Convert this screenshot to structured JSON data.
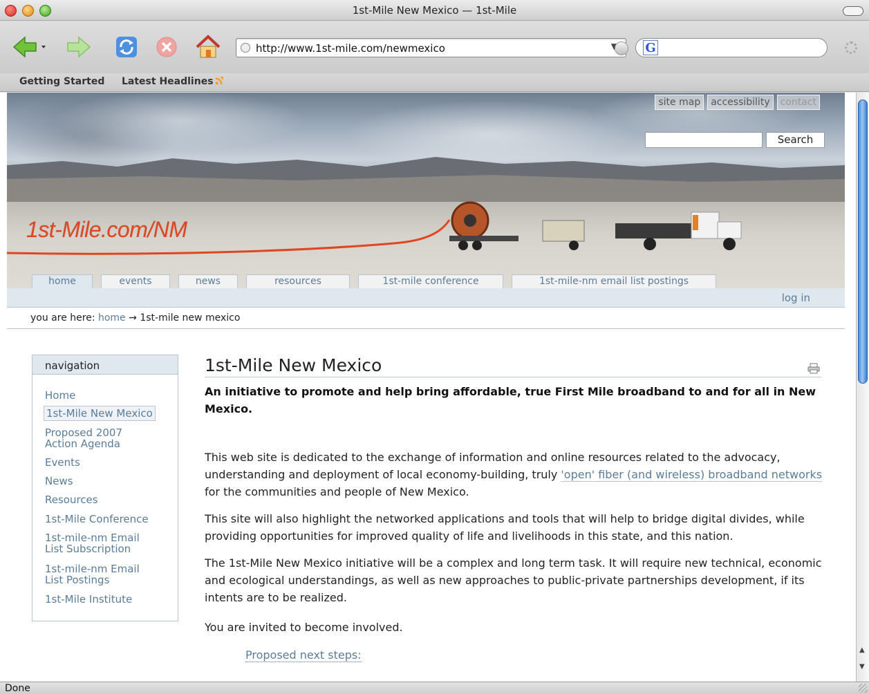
{
  "window": {
    "title": "1st-Mile New Mexico — 1st-Mile"
  },
  "toolbar": {
    "url": "http://www.1st-mile.com/newmexico",
    "search_engine_icon": "google-icon",
    "search_engine_letter": "G"
  },
  "bookmarks": [
    {
      "label": "Getting Started"
    },
    {
      "label": "Latest Headlines"
    }
  ],
  "site": {
    "logo": "1st-Mile.com/NM",
    "site_actions": [
      "site map",
      "accessibility",
      "contact"
    ],
    "search_button": "Search",
    "tabs": [
      "home",
      "events",
      "news",
      "resources",
      "1st-mile conference",
      "1st-mile-nm email list postings"
    ],
    "login": "log in",
    "colors": {
      "accent": "#5a7c99",
      "logo": "#e0451f",
      "portlet_bg": "#dfe7ef"
    }
  },
  "breadcrumb": {
    "prefix": "you are here:",
    "home": "home",
    "separator": "→",
    "current": "1st-mile new mexico"
  },
  "navigation": {
    "header": "navigation",
    "items": [
      {
        "label": "Home"
      },
      {
        "label": "1st-Mile New Mexico",
        "current": true
      },
      {
        "label": "Proposed 2007",
        "label2": "Action Agenda"
      },
      {
        "label": "Events"
      },
      {
        "label": "News"
      },
      {
        "label": "Resources"
      },
      {
        "label": "1st-Mile Conference"
      },
      {
        "label": "1st-mile-nm Email",
        "label2": "List Subscription"
      },
      {
        "label": "1st-mile-nm Email",
        "label2": "List Postings"
      },
      {
        "label": "1st-Mile Institute"
      }
    ]
  },
  "content": {
    "title": "1st-Mile New Mexico",
    "lead": "An initiative to promote and help bring affordable, true First Mile broadband to and for all in New Mexico.",
    "p1_before": "This web site is dedicated to the exchange of information and online resources related to the advocacy, understanding and deployment of local economy-building, truly ",
    "p1_link": "'open' fiber (and wireless) broadband networks",
    "p1_after": " for the communities and people of New Mexico.",
    "p2": "This site will also highlight the networked applications and tools that will help to bridge digital divides, while providing opportunities for improved quality of life and livelihoods in this state, and this nation.",
    "p3": "The 1st-Mile New Mexico initiative will be a complex and long term task.  It will require new technical, economic and ecological understandings, as well as new approaches to public-private partnerships development, if its intents are to be realized.",
    "p4": "You are invited to become involved.",
    "next_steps": "Proposed next steps:"
  },
  "status": {
    "text": "Done"
  }
}
